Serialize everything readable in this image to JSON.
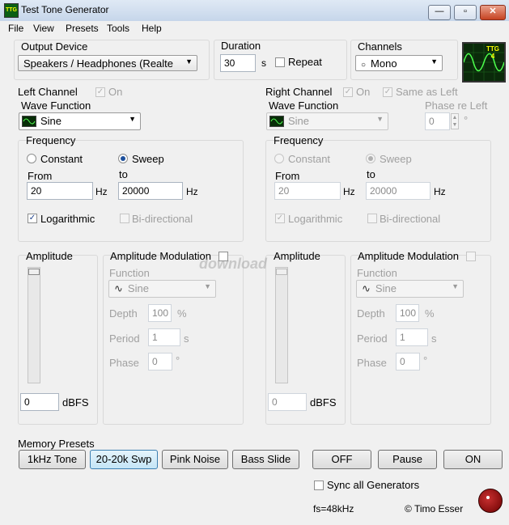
{
  "window": {
    "title": "Test Tone Generator"
  },
  "menu": [
    "File",
    "View",
    "Presets",
    "Tools",
    "Help"
  ],
  "output_device": {
    "label": "Output Device",
    "value": "Speakers / Headphones (Realte"
  },
  "duration": {
    "label": "Duration",
    "value": "30",
    "unit": "s",
    "repeat_label": "Repeat"
  },
  "channels": {
    "label": "Channels",
    "value": "Mono"
  },
  "scope_logo": "TTG\n4",
  "left": {
    "title": "Left Channel",
    "on_label": "On",
    "wave_label": "Wave Function",
    "wave_value": "Sine",
    "freq_label": "Frequency",
    "constant_label": "Constant",
    "sweep_label": "Sweep",
    "from_label": "From",
    "to_label": "to",
    "from_value": "20",
    "to_value": "20000",
    "hz": "Hz",
    "log_label": "Logarithmic",
    "bidir_label": "Bi-directional",
    "amp_label": "Amplitude",
    "amp_value": "0",
    "dbfs": "dBFS",
    "am_label": "Amplitude Modulation",
    "func_label": "Function",
    "func_value": "Sine",
    "depth_label": "Depth",
    "depth_value": "100",
    "pct": "%",
    "period_label": "Period",
    "period_value": "1",
    "s": "s",
    "phase_label": "Phase",
    "phase_value": "0",
    "deg": "°"
  },
  "right": {
    "title": "Right Channel",
    "on_label": "On",
    "same_label": "Same as Left",
    "phase_re_left_label": "Phase re Left",
    "phase_re_left_value": "0",
    "wave_label": "Wave Function",
    "wave_value": "Sine",
    "freq_label": "Frequency",
    "constant_label": "Constant",
    "sweep_label": "Sweep",
    "from_label": "From",
    "to_label": "to",
    "from_value": "20",
    "to_value": "20000",
    "hz": "Hz",
    "log_label": "Logarithmic",
    "bidir_label": "Bi-directional",
    "amp_label": "Amplitude",
    "amp_value": "0",
    "dbfs": "dBFS",
    "am_label": "Amplitude Modulation",
    "func_label": "Function",
    "func_value": "Sine",
    "depth_label": "Depth",
    "depth_value": "100",
    "pct": "%",
    "period_label": "Period",
    "period_value": "1",
    "s": "s",
    "phase_label": "Phase",
    "phase_value": "0",
    "deg": "°"
  },
  "presets": {
    "label": "Memory Presets",
    "buttons": [
      "1kHz Tone",
      "20-20k Swp",
      "Pink Noise",
      "Bass Slide"
    ]
  },
  "controls": {
    "off": "OFF",
    "pause": "Pause",
    "on": "ON",
    "sync_label": "Sync all Generators"
  },
  "status": {
    "fs": "fs=48kHz",
    "copyright": "© Timo Esser"
  },
  "watermark": "download"
}
